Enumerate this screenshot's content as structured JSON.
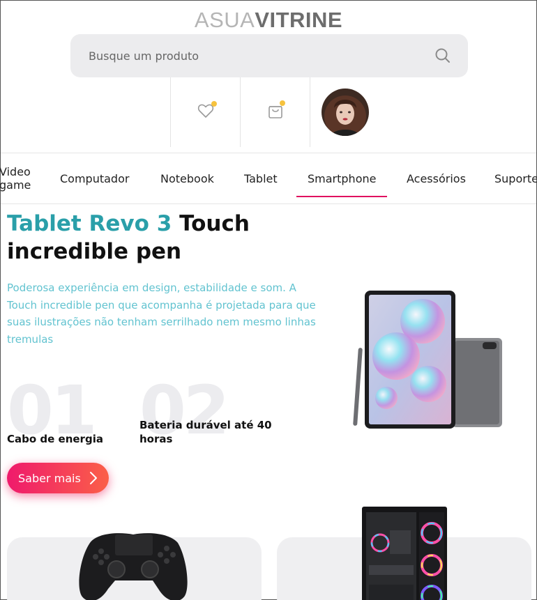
{
  "header": {
    "logo_light": "ASUA",
    "logo_bold": "VITRINE",
    "search_placeholder": "Busque um produto"
  },
  "nav": {
    "items": [
      {
        "label": "Video game"
      },
      {
        "label": "Computador"
      },
      {
        "label": "Notebook"
      },
      {
        "label": "Tablet"
      },
      {
        "label": "Smartphone",
        "active": true
      },
      {
        "label": "Acessórios"
      },
      {
        "label": "Suporte"
      }
    ]
  },
  "hero": {
    "title_accent": "Tablet Revo 3",
    "title_rest": " Touch incredible pen",
    "description": "Poderosa experiência em design, estabilidade e som. A Touch incredible pen que acompanha é projetada para que suas ilustrações não tenham serrilhado nem mesmo linhas tremulas",
    "features": [
      {
        "number": "01",
        "label": "Cabo de energia"
      },
      {
        "number": "02",
        "label": "Bateria durável até 40 horas"
      }
    ],
    "cta_label": "Saber mais"
  },
  "colors": {
    "accent": "#2a9fa9",
    "description": "#62c3d0",
    "active_underline": "#e0115f",
    "cta_gradient_start": "#ef1a6c",
    "cta_gradient_end": "#fb5f48",
    "badge_dot": "#f6c23e"
  },
  "icons": {
    "search": "search-icon",
    "favorites": "heart-icon",
    "cart": "shopping-bag-icon"
  }
}
